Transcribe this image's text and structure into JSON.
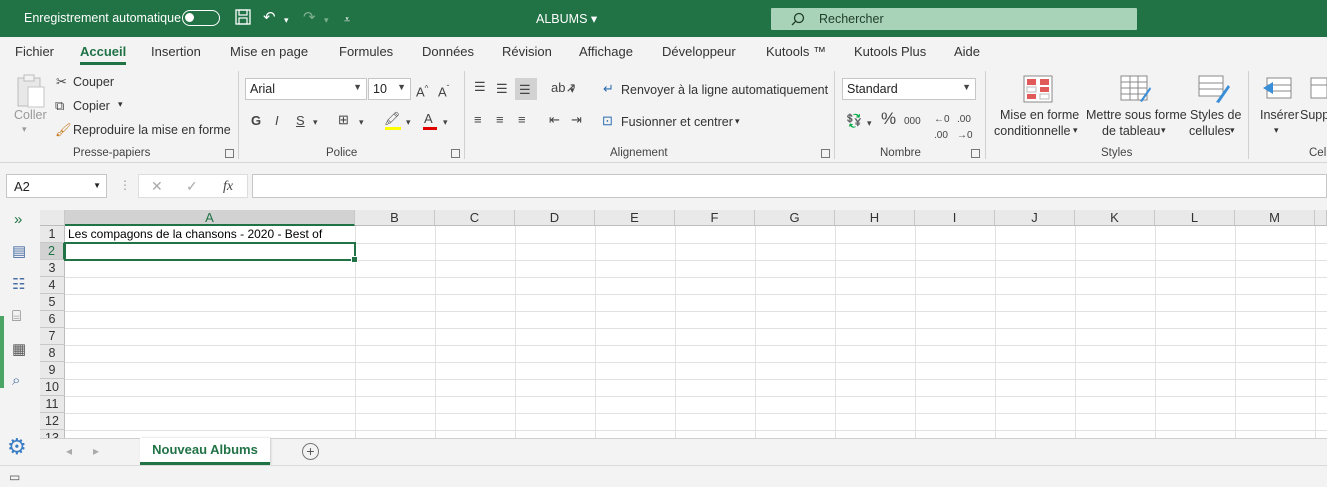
{
  "titlebar": {
    "autosave_label": "Enregistrement automatique",
    "doc_title": "ALBUMS",
    "search_placeholder": "Rechercher"
  },
  "menu": [
    "Fichier",
    "Accueil",
    "Insertion",
    "Mise en page",
    "Formules",
    "Données",
    "Révision",
    "Affichage",
    "Développeur",
    "Kutools ™",
    "Kutools Plus",
    "Aide"
  ],
  "ribbon": {
    "clipboard": {
      "paste": "Coller",
      "cut": "Couper",
      "copy": "Copier",
      "format_painter": "Reproduire la mise en forme",
      "title": "Presse-papiers"
    },
    "font": {
      "name": "Arial",
      "size": "10",
      "bold": "G",
      "italic": "I",
      "underline": "S",
      "title": "Police"
    },
    "alignment": {
      "wrap": "Renvoyer à la ligne automatiquement",
      "merge": "Fusionner et centrer",
      "title": "Alignement"
    },
    "number": {
      "format": "Standard",
      "percent": "%",
      "thousands": "000",
      "title": "Nombre"
    },
    "styles": {
      "conditional_1": "Mise en forme",
      "conditional_2": "conditionnelle",
      "table_1": "Mettre sous forme",
      "table_2": "de tableau",
      "cell_1": "Styles de",
      "cell_2": "cellules",
      "title": "Styles"
    },
    "cells": {
      "insert": "Insérer",
      "delete": "Supp",
      "title": "Cell"
    }
  },
  "formula": {
    "namebox": "A2",
    "fx": "fx",
    "value": ""
  },
  "columns": [
    "A",
    "B",
    "C",
    "D",
    "E",
    "F",
    "G",
    "H",
    "I",
    "J",
    "K",
    "L",
    "M"
  ],
  "rows": [
    "1",
    "2",
    "3",
    "4",
    "5",
    "6",
    "7",
    "8",
    "9",
    "10",
    "11",
    "12",
    "13"
  ],
  "cells": {
    "A1": "Les compagons de la chansons - 2020 - Best of"
  },
  "sheet_tab": "Nouveau Albums",
  "colors": {
    "accent": "#217346"
  }
}
